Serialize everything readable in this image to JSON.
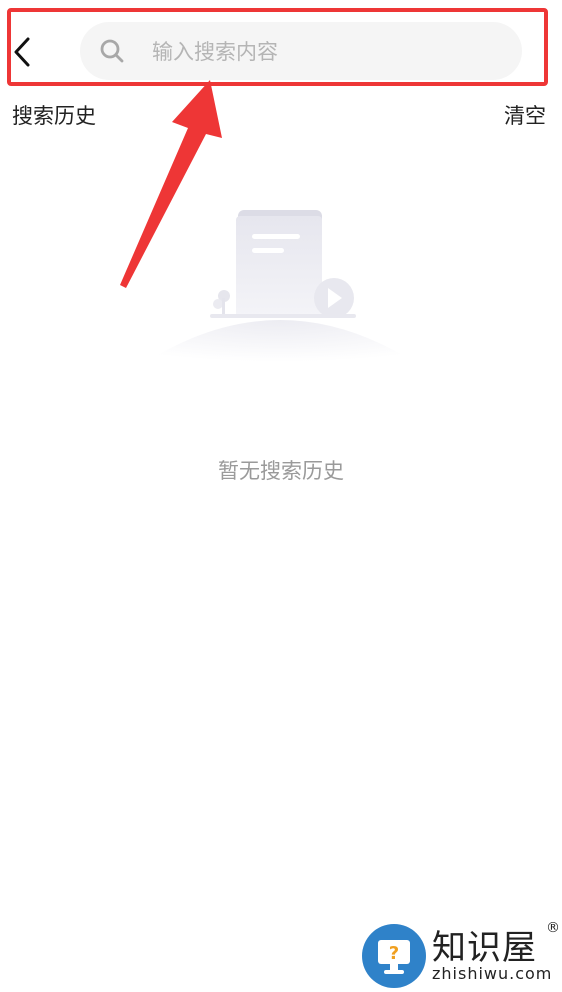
{
  "header": {
    "back_icon": "chevron-left-icon",
    "search": {
      "icon": "search-icon",
      "placeholder": "输入搜索内容",
      "value": ""
    }
  },
  "history": {
    "title": "搜索历史",
    "clear_label": "清空",
    "empty_text": "暂无搜索历史"
  },
  "annotation": {
    "highlight_color": "#ee3636"
  },
  "watermark": {
    "name": "知识屋",
    "reg_mark": "®",
    "domain": "zhishiwu.com",
    "brand_color": "#2f82c9"
  }
}
